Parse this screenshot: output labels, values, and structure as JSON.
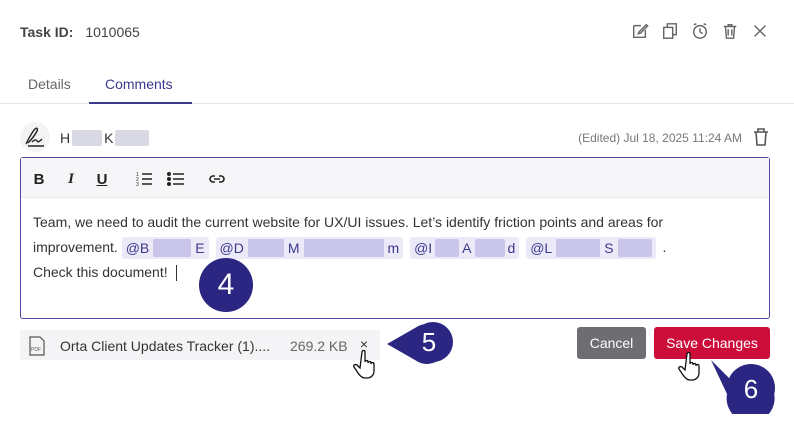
{
  "header": {
    "task_label": "Task ID:",
    "task_id": "1010065",
    "icons": [
      "edit-icon",
      "duplicate-icon",
      "alarm-clock-icon",
      "trash-icon",
      "close-icon"
    ]
  },
  "tabs": [
    {
      "label": "Details",
      "active": false
    },
    {
      "label": "Comments",
      "active": true
    }
  ],
  "comment": {
    "author_initial_1": "H",
    "author_initial_2": "K",
    "edited_stamp": "(Edited) Jul 18, 2025 11:24 AM",
    "text_line1": "Team, we need to audit the current website for UX/UI issues. Let’s identify friction points and areas for",
    "text_line2_prefix": "improvement.",
    "mentions": [
      {
        "prefix": "@B",
        "suffix": "E"
      },
      {
        "prefix": "@D",
        "mid": "M",
        "suffix": "m"
      },
      {
        "prefix": "@I",
        "mid": "A",
        "suffix": "d"
      },
      {
        "prefix": "@L",
        "mid": "S",
        "suffix": ""
      }
    ],
    "text_line2_end": ".",
    "text_line3": "Check this document!"
  },
  "toolbar": {
    "bold": "B",
    "italic": "I",
    "underline": "U",
    "icons": [
      "ordered-list-icon",
      "bullet-list-icon",
      "link-icon"
    ]
  },
  "attachment": {
    "name": "Orta Client Updates Tracker (1)....",
    "size": "269.2 KB",
    "remove": "×",
    "type_label": "PDF"
  },
  "buttons": {
    "cancel": "Cancel",
    "save": "Save Changes"
  },
  "callouts": {
    "c4": "4",
    "c5": "5",
    "c6": "6"
  },
  "colors": {
    "accent": "#3c3a8c",
    "save": "#cc0d3a",
    "cancel": "#6e6e72",
    "callout": "#2b2682",
    "editor_border": "#4a48a0"
  }
}
